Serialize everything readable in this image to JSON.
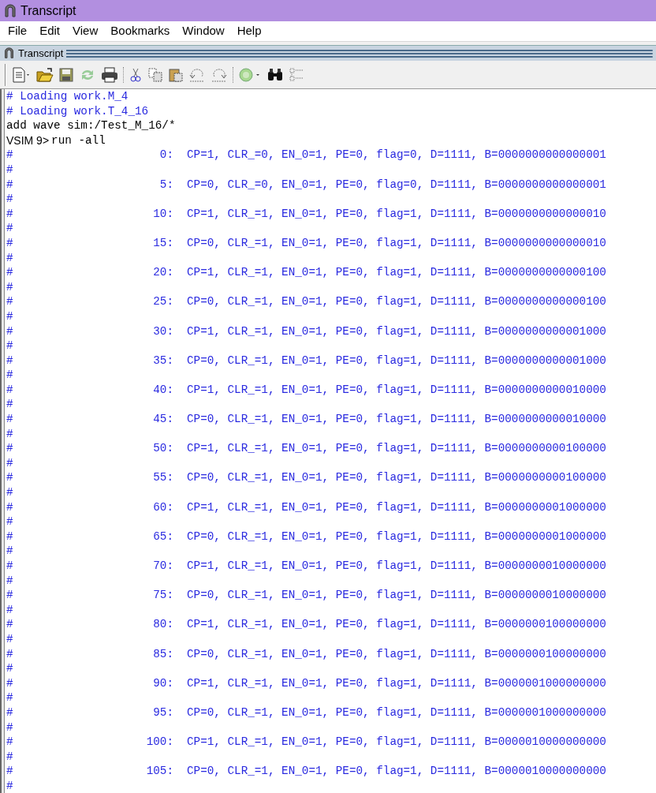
{
  "window": {
    "title": "Transcript"
  },
  "menu": [
    "File",
    "Edit",
    "View",
    "Bookmarks",
    "Window",
    "Help"
  ],
  "panel": {
    "title": "Transcript"
  },
  "lines": [
    {
      "kind": "echo",
      "text": "# Loading work.M_4"
    },
    {
      "kind": "echo",
      "text": "# Loading work.T_4_16"
    },
    {
      "kind": "command",
      "text": "add wave sim:/Test_M_16/*"
    },
    {
      "kind": "prompt",
      "prompt": "VSIM 9>",
      "text": "run -all"
    },
    {
      "kind": "result",
      "hash": "#",
      "time": "0:",
      "text": "CP=1, CLR_=0, EN_0=1, PE=0, flag=0, D=1111, B=0000000000000001"
    },
    {
      "kind": "hash",
      "hash": "#"
    },
    {
      "kind": "result",
      "hash": "#",
      "time": "5:",
      "text": "CP=0, CLR_=0, EN_0=1, PE=0, flag=0, D=1111, B=0000000000000001"
    },
    {
      "kind": "hash",
      "hash": "#"
    },
    {
      "kind": "result",
      "hash": "#",
      "time": "10:",
      "text": "CP=1, CLR_=1, EN_0=1, PE=0, flag=1, D=1111, B=0000000000000010"
    },
    {
      "kind": "hash",
      "hash": "#"
    },
    {
      "kind": "result",
      "hash": "#",
      "time": "15:",
      "text": "CP=0, CLR_=1, EN_0=1, PE=0, flag=1, D=1111, B=0000000000000010"
    },
    {
      "kind": "hash",
      "hash": "#"
    },
    {
      "kind": "result",
      "hash": "#",
      "time": "20:",
      "text": "CP=1, CLR_=1, EN_0=1, PE=0, flag=1, D=1111, B=0000000000000100"
    },
    {
      "kind": "hash",
      "hash": "#"
    },
    {
      "kind": "result",
      "hash": "#",
      "time": "25:",
      "text": "CP=0, CLR_=1, EN_0=1, PE=0, flag=1, D=1111, B=0000000000000100"
    },
    {
      "kind": "hash",
      "hash": "#"
    },
    {
      "kind": "result",
      "hash": "#",
      "time": "30:",
      "text": "CP=1, CLR_=1, EN_0=1, PE=0, flag=1, D=1111, B=0000000000001000"
    },
    {
      "kind": "hash",
      "hash": "#"
    },
    {
      "kind": "result",
      "hash": "#",
      "time": "35:",
      "text": "CP=0, CLR_=1, EN_0=1, PE=0, flag=1, D=1111, B=0000000000001000"
    },
    {
      "kind": "hash",
      "hash": "#"
    },
    {
      "kind": "result",
      "hash": "#",
      "time": "40:",
      "text": "CP=1, CLR_=1, EN_0=1, PE=0, flag=1, D=1111, B=0000000000010000"
    },
    {
      "kind": "hash",
      "hash": "#"
    },
    {
      "kind": "result",
      "hash": "#",
      "time": "45:",
      "text": "CP=0, CLR_=1, EN_0=1, PE=0, flag=1, D=1111, B=0000000000010000"
    },
    {
      "kind": "hash",
      "hash": "#"
    },
    {
      "kind": "result",
      "hash": "#",
      "time": "50:",
      "text": "CP=1, CLR_=1, EN_0=1, PE=0, flag=1, D=1111, B=0000000000100000"
    },
    {
      "kind": "hash",
      "hash": "#"
    },
    {
      "kind": "result",
      "hash": "#",
      "time": "55:",
      "text": "CP=0, CLR_=1, EN_0=1, PE=0, flag=1, D=1111, B=0000000000100000"
    },
    {
      "kind": "hash",
      "hash": "#"
    },
    {
      "kind": "result",
      "hash": "#",
      "time": "60:",
      "text": "CP=1, CLR_=1, EN_0=1, PE=0, flag=1, D=1111, B=0000000001000000"
    },
    {
      "kind": "hash",
      "hash": "#"
    },
    {
      "kind": "result",
      "hash": "#",
      "time": "65:",
      "text": "CP=0, CLR_=1, EN_0=1, PE=0, flag=1, D=1111, B=0000000001000000"
    },
    {
      "kind": "hash",
      "hash": "#"
    },
    {
      "kind": "result",
      "hash": "#",
      "time": "70:",
      "text": "CP=1, CLR_=1, EN_0=1, PE=0, flag=1, D=1111, B=0000000010000000"
    },
    {
      "kind": "hash",
      "hash": "#"
    },
    {
      "kind": "result",
      "hash": "#",
      "time": "75:",
      "text": "CP=0, CLR_=1, EN_0=1, PE=0, flag=1, D=1111, B=0000000010000000"
    },
    {
      "kind": "hash",
      "hash": "#"
    },
    {
      "kind": "result",
      "hash": "#",
      "time": "80:",
      "text": "CP=1, CLR_=1, EN_0=1, PE=0, flag=1, D=1111, B=0000000100000000"
    },
    {
      "kind": "hash",
      "hash": "#"
    },
    {
      "kind": "result",
      "hash": "#",
      "time": "85:",
      "text": "CP=0, CLR_=1, EN_0=1, PE=0, flag=1, D=1111, B=0000000100000000"
    },
    {
      "kind": "hash",
      "hash": "#"
    },
    {
      "kind": "result",
      "hash": "#",
      "time": "90:",
      "text": "CP=1, CLR_=1, EN_0=1, PE=0, flag=1, D=1111, B=0000001000000000"
    },
    {
      "kind": "hash",
      "hash": "#"
    },
    {
      "kind": "result",
      "hash": "#",
      "time": "95:",
      "text": "CP=0, CLR_=1, EN_0=1, PE=0, flag=1, D=1111, B=0000001000000000"
    },
    {
      "kind": "hash",
      "hash": "#"
    },
    {
      "kind": "result",
      "hash": "#",
      "time": "100:",
      "text": "CP=1, CLR_=1, EN_0=1, PE=0, flag=1, D=1111, B=0000010000000000"
    },
    {
      "kind": "hash",
      "hash": "#"
    },
    {
      "kind": "result",
      "hash": "#",
      "time": "105:",
      "text": "CP=0, CLR_=1, EN_0=1, PE=0, flag=1, D=1111, B=0000010000000000"
    },
    {
      "kind": "hash",
      "hash": "#"
    }
  ]
}
